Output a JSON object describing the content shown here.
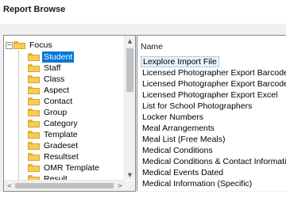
{
  "window": {
    "title": "Report Browse"
  },
  "tree": {
    "root": {
      "label": "Focus",
      "expander": "−"
    },
    "children": [
      {
        "label": "Student",
        "selected": true
      },
      {
        "label": "Staff"
      },
      {
        "label": "Class"
      },
      {
        "label": "Aspect"
      },
      {
        "label": "Contact"
      },
      {
        "label": "Group"
      },
      {
        "label": "Category"
      },
      {
        "label": "Template"
      },
      {
        "label": "Gradeset"
      },
      {
        "label": "Resultset"
      },
      {
        "label": "OMR Template"
      },
      {
        "label": "Result"
      }
    ]
  },
  "list": {
    "column_header": "Name",
    "items": [
      "Lexplore Import File",
      "Licensed Photographer Export Barcode",
      "Licensed Photographer Export Barcode HT",
      "Licensed Photographer Export Excel",
      "List for School Photographers",
      "Locker Numbers",
      "Meal Arrangements",
      "Meal List (Free Meals)",
      "Medical Conditions",
      "Medical Conditions & Contact Information",
      "Medical Events Dated",
      "Medical Information (Specific)"
    ]
  },
  "scrollbars": {
    "up_arrow": "▲",
    "down_arrow": "▼",
    "left_arrow": "<",
    "right_arrow": ">"
  },
  "colors": {
    "selection": "#0078d7",
    "folder": "#f7cc52",
    "frame": "#f0f0f0"
  }
}
